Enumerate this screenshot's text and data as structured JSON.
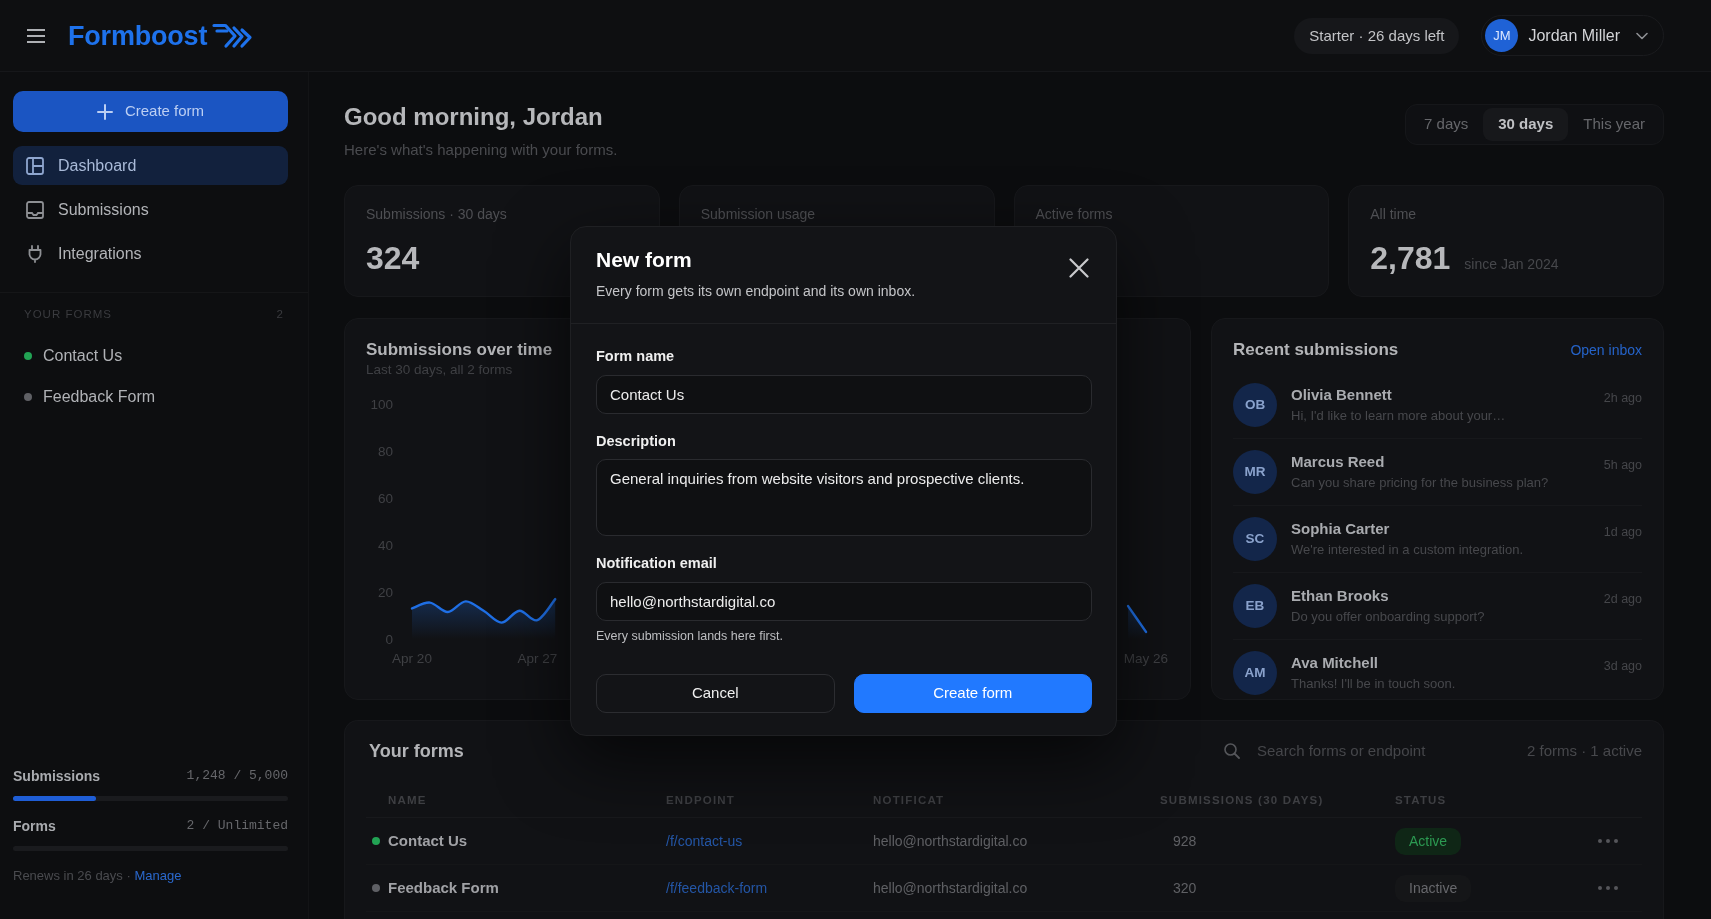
{
  "header": {
    "logo": "Formboost",
    "plan": "Starter · 26 days left",
    "user": {
      "initials": "JM",
      "name": "Jordan Miller"
    }
  },
  "sidebar": {
    "create_button": "Create form",
    "nav": [
      {
        "label": "Dashboard",
        "selected": true
      },
      {
        "label": "Submissions",
        "selected": false
      },
      {
        "label": "Integrations",
        "selected": false
      }
    ],
    "forms_heading": "YOUR FORMS",
    "forms_count": "2",
    "forms": [
      {
        "name": "Contact Us",
        "color": "#22a354"
      },
      {
        "name": "Feedback Form",
        "color": "#5f6065"
      }
    ],
    "usage": [
      {
        "label": "Submissions",
        "reading": "1,248 / 5,000",
        "level": 0.3
      },
      {
        "label": "Forms",
        "reading": "2 / Unlimited"
      }
    ],
    "renewal": {
      "text": "Renews in 26 days ·",
      "link": "Manage"
    }
  },
  "dashboard": {
    "greeting": "Good morning, Jordan",
    "subtitle": "Here's what's happening with your forms.",
    "ranges": [
      {
        "label": "7 days",
        "selected": false
      },
      {
        "label": "30 days",
        "selected": true
      },
      {
        "label": "This year",
        "selected": false
      }
    ],
    "stats": [
      {
        "label": "Submissions · 30 days",
        "value": "324"
      },
      {
        "label": "Submission usage"
      },
      {
        "label": "Active forms"
      },
      {
        "label": "All time",
        "value": "2,781",
        "note": "since Jan 2024"
      }
    ],
    "chart": {
      "title": "Submissions over time",
      "subtitle": "Last 30 days, all 2 forms",
      "chart_data": {
        "type": "area",
        "ylim": [
          0,
          100
        ],
        "yticks": [
          0,
          20,
          40,
          60,
          80,
          100
        ],
        "categories": [
          "Apr 20",
          null,
          null,
          null,
          null,
          null,
          null,
          "Apr 27",
          null,
          null,
          null,
          null,
          null,
          null,
          null,
          null,
          null,
          null,
          null,
          null,
          null,
          null,
          null,
          null,
          null,
          null,
          null,
          null,
          null,
          null,
          null,
          null,
          null,
          null,
          null,
          null,
          null,
          null,
          null,
          null,
          null,
          "May 26"
        ],
        "series": [
          {
            "color": "#1f6fe5",
            "values": [
              13,
              15.5,
              11.5,
              16,
              12,
              7,
              12,
              8,
              17,
              null,
              null,
              null,
              null,
              null,
              null,
              null,
              null,
              null,
              null,
              null,
              null,
              null,
              null,
              null,
              null,
              null,
              null,
              null,
              null,
              null,
              null,
              null,
              null,
              null,
              null,
              null,
              null,
              null,
              null,
              null,
              14,
              3
            ]
          }
        ]
      }
    },
    "recent": {
      "title": "Recent submissions",
      "link": "Open inbox",
      "items": [
        {
          "initials": "OB",
          "name": "Olivia Bennett",
          "message": "Hi, I'd like to learn more about your…",
          "time": "2h ago"
        },
        {
          "initials": "MR",
          "name": "Marcus Reed",
          "message": "Can you share pricing for the business plan?",
          "time": "5h ago"
        },
        {
          "initials": "SC",
          "name": "Sophia Carter",
          "message": "We're interested in a custom integration.",
          "time": "1d ago"
        },
        {
          "initials": "EB",
          "name": "Ethan Brooks",
          "message": "Do you offer onboarding support?",
          "time": "2d ago"
        },
        {
          "initials": "AM",
          "name": "Ava Mitchell",
          "message": "Thanks! I'll be in touch soon.",
          "time": "3d ago"
        }
      ]
    },
    "forms_table": {
      "title": "Your forms",
      "search": {
        "placeholder": "Search forms or endpoint"
      },
      "summary": "2 forms · 1 active",
      "columns": [
        "NAME",
        "ENDPOINT",
        "NOTIFICAT",
        "SUBMISSIONS (30 DAYS)",
        "STATUS"
      ],
      "rows": [
        {
          "name": "Contact Us",
          "color": "#22a354",
          "endpoint": "/f/contact-us",
          "notification": "hello@northstardigital.co",
          "submissions": "928",
          "status": {
            "label": "Active",
            "kind": "active"
          }
        },
        {
          "name": "Feedback Form",
          "color": "#5f6065",
          "endpoint": "/f/feedback-form",
          "notification": "hello@northstardigital.co",
          "submissions": "320",
          "status": {
            "label": "Inactive",
            "kind": "inactive"
          }
        }
      ]
    }
  },
  "modal": {
    "title": "New form",
    "subtitle": "Every form gets its own endpoint and its own inbox.",
    "fields": [
      {
        "kind": "input",
        "label": "Form name",
        "value": "Contact Us"
      },
      {
        "kind": "textarea",
        "label": "Description",
        "value": "General inquiries from website visitors and prospective clients."
      },
      {
        "kind": "input",
        "label": "Notification email",
        "value": "hello@northstardigital.co",
        "hint": "Every submission lands here first."
      }
    ],
    "buttons": [
      {
        "kind": "secondary",
        "label": "Cancel"
      },
      {
        "kind": "primary",
        "label": "Create form"
      }
    ]
  }
}
